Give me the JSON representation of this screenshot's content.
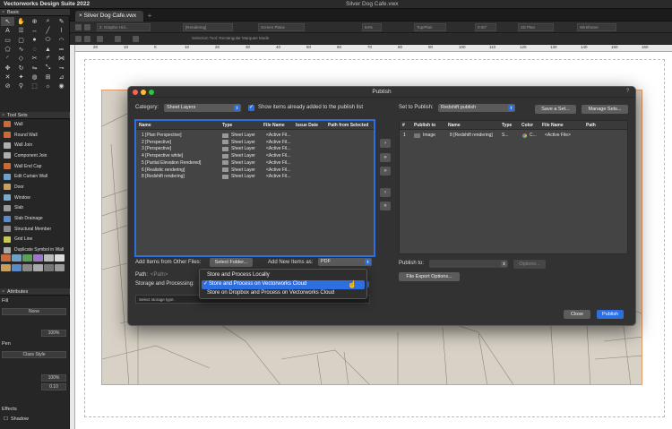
{
  "app": {
    "title": "Vectorworks Design Suite 2022",
    "window_title": "Silver Dog Cafe.vwx"
  },
  "document_tab": {
    "label": "Silver Dog Cafe.vwx"
  },
  "view_bar": {
    "fields": [
      "2. Graphic Hid...",
      "[Rendering]",
      "Screen Plane",
      "64%",
      "Top/Plan",
      "0.00°",
      "2D Plan",
      "Wireframe"
    ],
    "mode_hint": "Selection Tool: Rectangular Marquee Mode"
  },
  "ruler_numbers": [
    "20",
    "10",
    "0",
    "10",
    "20",
    "30",
    "40",
    "50",
    "60",
    "70",
    "80",
    "90",
    "100",
    "110",
    "120",
    "130",
    "140",
    "150",
    "160"
  ],
  "palettes": {
    "basic": "Basic",
    "tool_sets": "Tool Sets",
    "tools": [
      {
        "label": "Wall",
        "color": "#c86a3a"
      },
      {
        "label": "Round Wall",
        "color": "#c86a3a"
      },
      {
        "label": "Wall Join",
        "color": "#b0b0b0"
      },
      {
        "label": "Component Join",
        "color": "#b0b0b0"
      },
      {
        "label": "Wall End Cap",
        "color": "#c86a3a"
      },
      {
        "label": "Edit Curtain Wall",
        "color": "#6fa0c8"
      },
      {
        "label": "Door",
        "color": "#c8a05a"
      },
      {
        "label": "Window",
        "color": "#7aaad0"
      },
      {
        "label": "Slab",
        "color": "#9a9a9a"
      },
      {
        "label": "Slab Drainage",
        "color": "#5a8ac8"
      },
      {
        "label": "Structural Member",
        "color": "#8a8a8a"
      },
      {
        "label": "Grid Line",
        "color": "#c8c85a"
      },
      {
        "label": "Duplicate Symbol in Wall",
        "color": "#aaa"
      }
    ],
    "attributes": "Attributes",
    "fill_label": "Fill",
    "fill_value": "None",
    "opacity_value": "100%",
    "pen_label": "Pen",
    "pen_value": "Class Style",
    "pen_opacity": "100%",
    "line_weight": "0.10",
    "effects_label": "Effects",
    "shadow_label": "Shadow"
  },
  "dialog": {
    "title": "Publish",
    "help": "?",
    "category_label": "Category:",
    "category_value": "Sheet Layers",
    "show_items_label": "Show items already added to the publish list",
    "set_label": "Set to Publish:",
    "set_value": "Redshift publish",
    "save_set": "Save a Set...",
    "manage_sets": "Manage Sets...",
    "left_columns": [
      "Name",
      "Type",
      "File Name",
      "Issue Date",
      "Path from Selected"
    ],
    "left_rows": [
      {
        "name": "1 [Plan Perspective]",
        "type": "Sheet Layer",
        "file": "<Active Fil..."
      },
      {
        "name": "2 [Perspective]",
        "type": "Sheet Layer",
        "file": "<Active Fil..."
      },
      {
        "name": "3 [Perspective]",
        "type": "Sheet Layer",
        "file": "<Active Fil..."
      },
      {
        "name": "4 [Perspective white]",
        "type": "Sheet Layer",
        "file": "<Active Fil..."
      },
      {
        "name": "5 [Partial Elevation Rendered]",
        "type": "Sheet Layer",
        "file": "<Active Fil..."
      },
      {
        "name": "6 [Realistic rendering]",
        "type": "Sheet Layer",
        "file": "<Active Fil..."
      },
      {
        "name": "8 [Redshift rendering]",
        "type": "Sheet Layer",
        "file": "<Active Fil..."
      }
    ],
    "right_columns": [
      "#",
      "Publish to",
      "Name",
      "Type",
      "Color",
      "File Name",
      "Path"
    ],
    "right_rows": [
      {
        "num": "1",
        "publish_to": "Image",
        "name": "8 [Redshift rendering]",
        "type": "S...",
        "color": "C...",
        "file": "<Active File>"
      }
    ],
    "arrows": [
      "›",
      "»",
      "»",
      "‹",
      "«"
    ],
    "add_items_label": "Add Items from Other Files:",
    "select_folder": "Select Folder...",
    "add_new_as_label": "Add New Items as:",
    "add_new_as_value": "PDF",
    "path_label": "Path:",
    "path_value": "<Path>",
    "storage_label": "Storage and Processing:",
    "storage_desc": "Select storage type.",
    "publish_to_label": "Publish to:",
    "options": "Options...",
    "file_export_options": "File Export Options...",
    "close": "Close",
    "publish": "Publish"
  },
  "storage_menu": {
    "items": [
      {
        "label": "Store and Process Locally",
        "checked": false
      },
      {
        "label": "Store and Process on Vectorworks Cloud",
        "checked": true
      },
      {
        "label": "Store on Dropbox and Process on Vectorworks Cloud",
        "checked": false
      }
    ],
    "check_mark": "✓"
  },
  "colors": {
    "accent": "#2d6ee0",
    "dialog_bg": "#323232",
    "drawing_fill": "#d8d1c5",
    "drawing_border": "#e59a6a"
  }
}
